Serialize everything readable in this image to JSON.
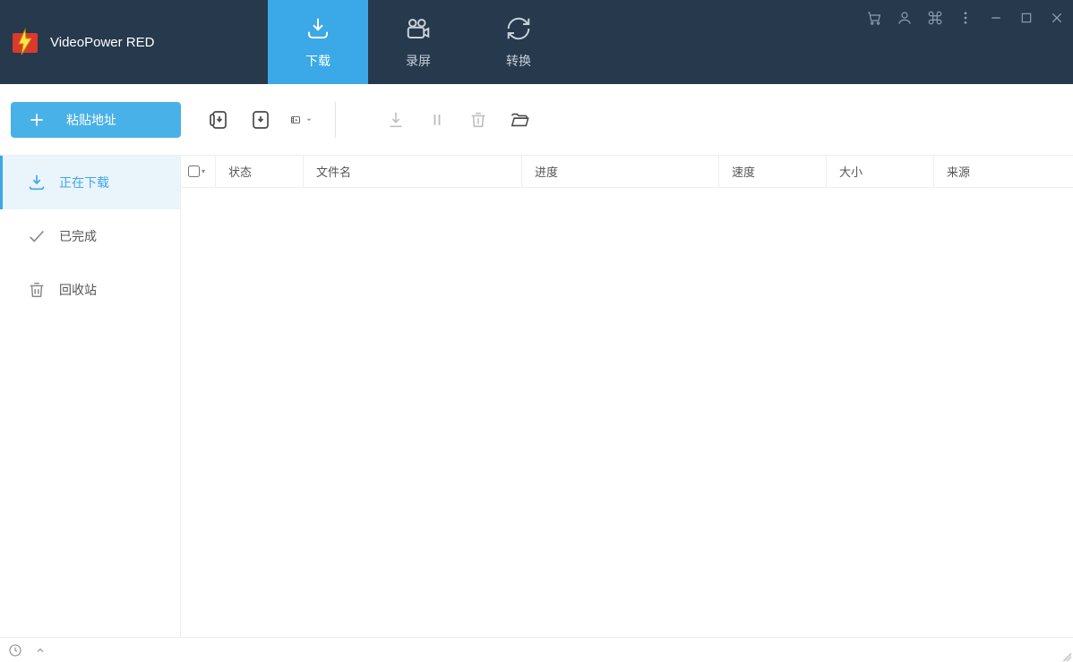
{
  "app": {
    "title": "VideoPower RED"
  },
  "nav": {
    "tabs": [
      {
        "label": "下载",
        "key": "download",
        "active": true
      },
      {
        "label": "录屏",
        "key": "record",
        "active": false
      },
      {
        "label": "转换",
        "key": "convert",
        "active": false
      }
    ]
  },
  "window_controls": {
    "cart": "cart-icon",
    "user": "user-icon",
    "shortcuts": "command-icon",
    "more": "more-icon",
    "minimize": "minimize-icon",
    "maximize": "maximize-icon",
    "close": "close-icon"
  },
  "toolbar": {
    "paste_url_label": "粘贴地址",
    "icons": {
      "batch_save": "batch-download-icon",
      "one_save": "download-file-icon",
      "video_settings": "video-settings-icon",
      "start": "start-icon",
      "pause": "pause-icon",
      "delete": "delete-icon",
      "open_folder": "open-folder-icon"
    }
  },
  "sidebar": {
    "items": [
      {
        "label": "正在下载",
        "key": "downloading",
        "active": true
      },
      {
        "label": "已完成",
        "key": "completed",
        "active": false
      },
      {
        "label": "回收站",
        "key": "trash",
        "active": false
      }
    ]
  },
  "table": {
    "columns": {
      "status": "状态",
      "name": "文件名",
      "progress": "进度",
      "speed": "速度",
      "size": "大小",
      "source": "来源"
    },
    "rows": []
  },
  "statusbar": {
    "clock": "clock-icon",
    "expand": "expand-icon"
  },
  "colors": {
    "accent": "#3ba8e7",
    "titlebar": "#26394d",
    "button": "#48b1e8"
  }
}
